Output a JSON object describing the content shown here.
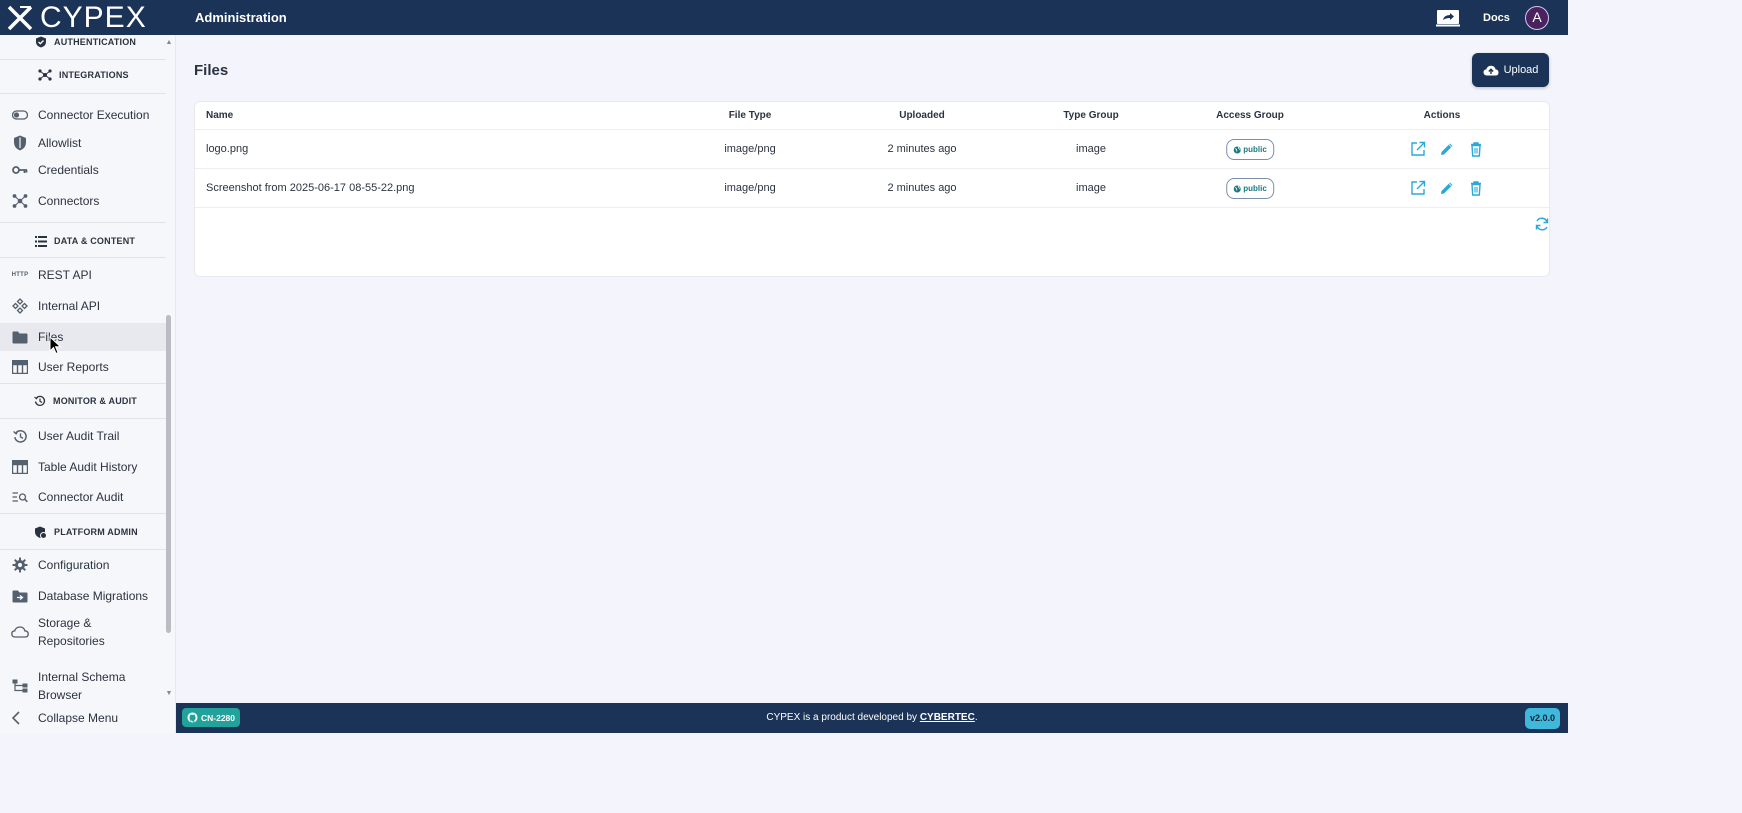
{
  "header": {
    "brand": "CYPEX",
    "title": "Administration",
    "docs_label": "Docs",
    "avatar_letter": "A"
  },
  "sidebar": {
    "sections": [
      {
        "label": "AUTHENTICATION",
        "icon": "shield-check-icon"
      },
      {
        "label": "INTEGRATIONS",
        "icon": "hub-icon"
      },
      {
        "label": "DATA & CONTENT",
        "icon": "list-icon"
      },
      {
        "label": "MONITOR & AUDIT",
        "icon": "history-icon"
      },
      {
        "label": "PLATFORM ADMIN",
        "icon": "admin-shield-icon"
      }
    ],
    "items": [
      {
        "label": "Connector Execution",
        "icon": "toggle-icon"
      },
      {
        "label": "Allowlist",
        "icon": "shield-icon"
      },
      {
        "label": "Credentials",
        "icon": "key-icon"
      },
      {
        "label": "Connectors",
        "icon": "hub-icon"
      },
      {
        "label": "REST API",
        "icon": "http-icon"
      },
      {
        "label": "Internal API",
        "icon": "api-icon"
      },
      {
        "label": "Files",
        "icon": "folder-icon"
      },
      {
        "label": "User Reports",
        "icon": "table-icon"
      },
      {
        "label": "User Audit Trail",
        "icon": "history-icon"
      },
      {
        "label": "Table Audit History",
        "icon": "table-icon"
      },
      {
        "label": "Connector Audit",
        "icon": "search-list-icon"
      },
      {
        "label": "Configuration",
        "icon": "gear-icon"
      },
      {
        "label": "Database Migrations",
        "icon": "folder-move-icon"
      },
      {
        "label": "Storage & Repositories",
        "icon": "cloud-icon"
      },
      {
        "label": "Internal Schema Browser",
        "icon": "schema-icon"
      }
    ],
    "collapse_label": "Collapse Menu"
  },
  "main": {
    "title": "Files",
    "upload_label": "Upload",
    "columns": [
      "Name",
      "File Type",
      "Uploaded",
      "Type Group",
      "Access Group",
      "Actions"
    ],
    "rows": [
      {
        "name": "logo.png",
        "file_type": "image/png",
        "uploaded": "2 minutes ago",
        "type_group": "image",
        "access_group": "public"
      },
      {
        "name": "Screenshot from 2025-06-17 08-55-22.png",
        "file_type": "image/png",
        "uploaded": "2 minutes ago",
        "type_group": "image",
        "access_group": "public"
      }
    ]
  },
  "footer": {
    "ticket": "CN-2280",
    "text_prefix": "CYPEX is a product developed by ",
    "link": "CYBERTEC",
    "text_suffix": ".",
    "version": "v2.0.0"
  },
  "colors": {
    "navy": "#1a3357",
    "teal_badge": "#21a29a",
    "action_icon": "#2aa8d8",
    "version_badge": "#3fb8dc"
  }
}
